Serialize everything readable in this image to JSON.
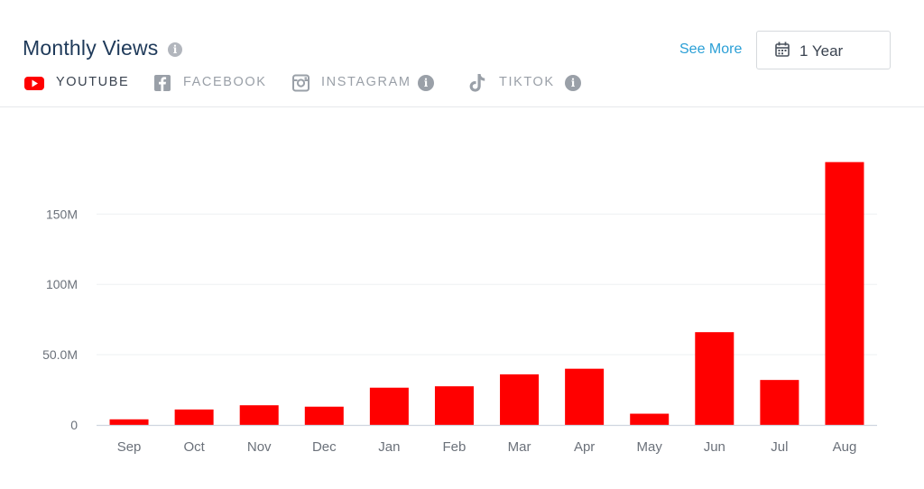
{
  "header": {
    "title": "Monthly Views",
    "title_info_icon": "info-icon",
    "see_more_label": "See More",
    "range_label": "1 Year",
    "range_icon": "calendar-icon"
  },
  "tabs": [
    {
      "label": "YOUTUBE",
      "icon": "youtube-icon",
      "active": true
    },
    {
      "label": "FACEBOOK",
      "icon": "facebook-icon",
      "active": false
    },
    {
      "label": "INSTAGRAM",
      "icon": "instagram-icon",
      "active": false
    },
    {
      "label": "TIKTOK",
      "icon": "tiktok-icon",
      "active": false
    }
  ],
  "colors": {
    "bar": "#ff0000",
    "title": "#1f3a5a",
    "link": "#2a9fd6",
    "muted": "#9aa0a8"
  },
  "chart_data": {
    "type": "bar",
    "categories": [
      "Sep",
      "Oct",
      "Nov",
      "Dec",
      "Jan",
      "Feb",
      "Mar",
      "Apr",
      "May",
      "Jun",
      "Jul",
      "Aug"
    ],
    "values": [
      4,
      11,
      14,
      13,
      26.5,
      27.5,
      36,
      40,
      8,
      66,
      32,
      187
    ],
    "unit": "M",
    "yticks": [
      0,
      50,
      100,
      150
    ],
    "ytick_labels": [
      "0",
      "50.0M",
      "100M",
      "150M"
    ],
    "ylim": [
      0,
      200
    ],
    "grid": true
  }
}
